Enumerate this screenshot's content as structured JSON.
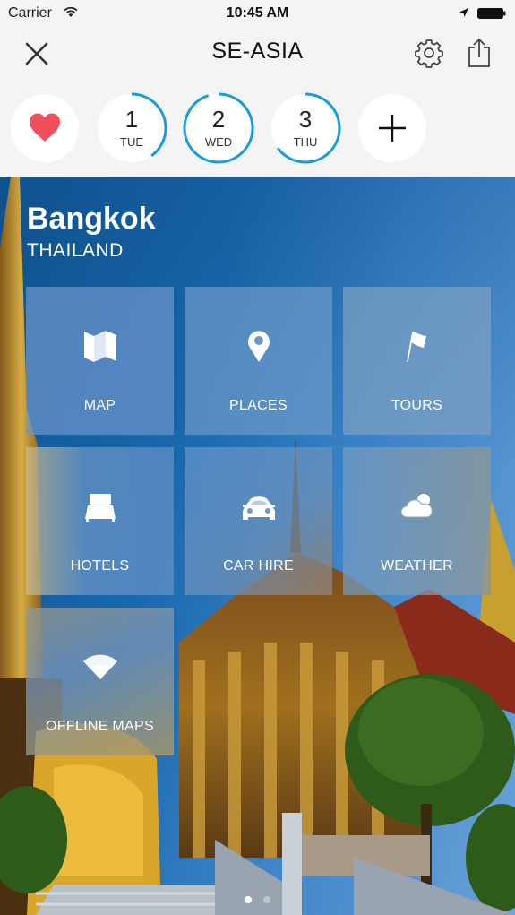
{
  "status_bar": {
    "carrier": "Carrier",
    "time": "10:45 AM"
  },
  "nav": {
    "title": "SE-ASIA",
    "close_icon": "close-icon",
    "settings_icon": "gear-icon",
    "share_icon": "share-icon"
  },
  "days": {
    "favorite_icon": "heart-icon",
    "favorite_color": "#f0505a",
    "accent_color": "#1a9ae0",
    "items": [
      {
        "number": "1",
        "weekday": "TUE",
        "progress": 0.4
      },
      {
        "number": "2",
        "weekday": "WED",
        "progress": 0.95
      },
      {
        "number": "3",
        "weekday": "THU",
        "progress": 0.65
      }
    ],
    "add_icon": "plus-icon"
  },
  "destination": {
    "city": "Bangkok",
    "country": "THAILAND"
  },
  "tiles": [
    {
      "label": "MAP",
      "icon": "map-icon"
    },
    {
      "label": "PLACES",
      "icon": "location-pin-icon"
    },
    {
      "label": "TOURS",
      "icon": "flag-icon"
    },
    {
      "label": "HOTELS",
      "icon": "bed-icon"
    },
    {
      "label": "CAR HIRE",
      "icon": "car-icon"
    },
    {
      "label": "WEATHER",
      "icon": "cloud-sun-icon"
    },
    {
      "label": "OFFLINE MAPS",
      "icon": "wifi-icon"
    }
  ],
  "pager": {
    "pages": 2,
    "current": 1
  }
}
